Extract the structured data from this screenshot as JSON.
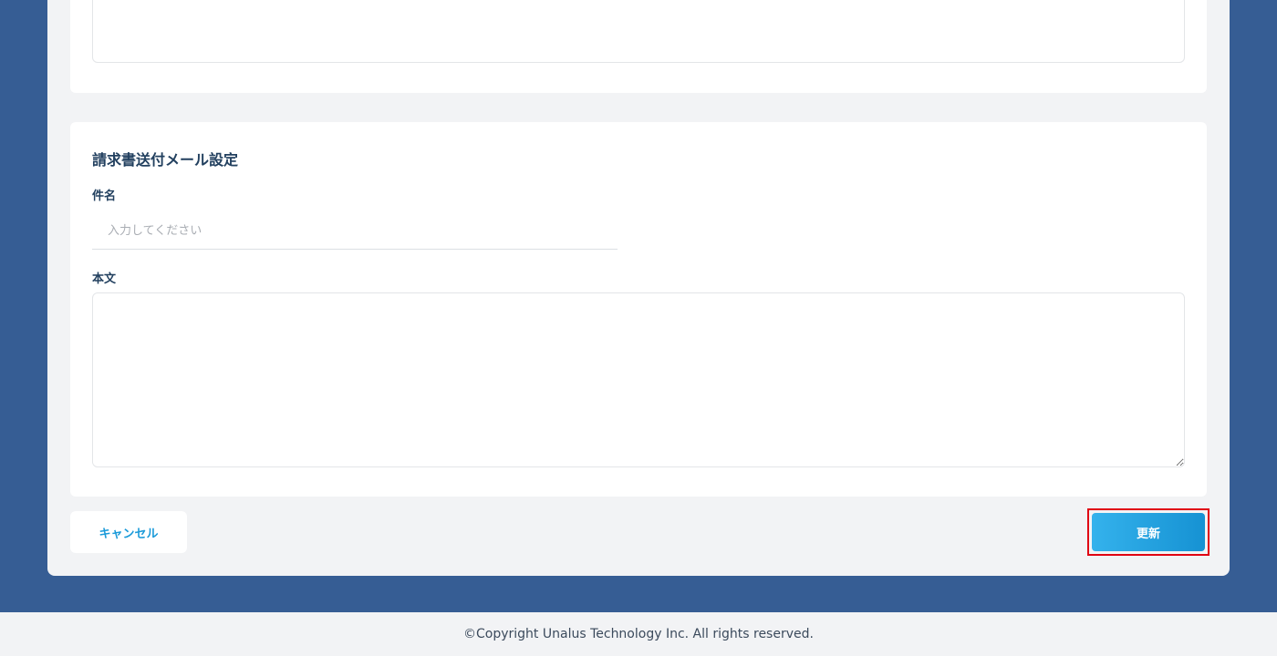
{
  "mail_settings": {
    "section_title": "請求書送付メール設定",
    "subject_label": "件名",
    "subject_placeholder": "入力してください",
    "subject_value": "",
    "body_label": "本文",
    "body_value": ""
  },
  "actions": {
    "cancel_label": "キャンセル",
    "update_label": "更新"
  },
  "footer": {
    "copyright": "©Copyright Unalus Technology Inc. All rights reserved."
  },
  "colors": {
    "page_background": "#365d94",
    "panel_background": "#f2f3f5",
    "heading_text": "#22405f",
    "accent": "#1a9ad9",
    "highlight": "#e00012"
  }
}
